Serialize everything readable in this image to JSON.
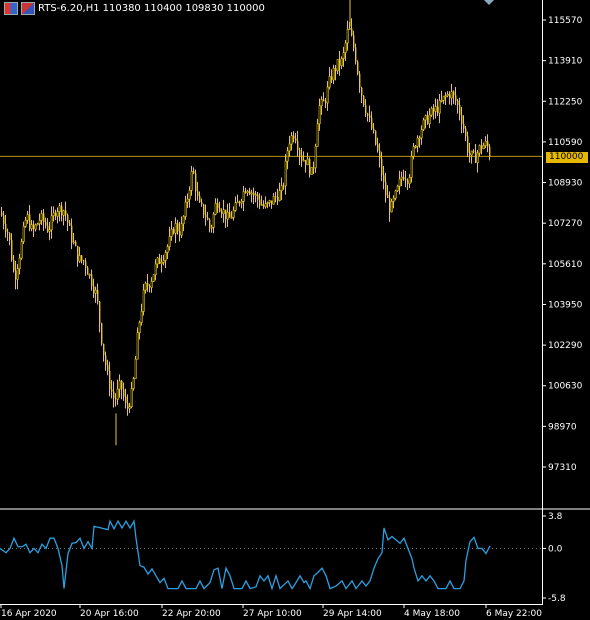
{
  "header": {
    "symbol": "RTS-6.20,H1",
    "ohlc": "110380 110400 109830 110000",
    "icons": [
      "chart-icon",
      "flag-icon"
    ]
  },
  "current_price_label": "110000",
  "colors": {
    "background": "#000000",
    "candle": "#e8c82e",
    "price_line": "#b8960f",
    "indicator": "#2a9fe0",
    "price_tag": "#e6b800"
  },
  "chart_data": [
    {
      "type": "candlestick",
      "ylim": [
        96000,
        117000
      ],
      "y_ticks": [
        "115570",
        "113910",
        "112250",
        "110590",
        "110000",
        "108930",
        "107270",
        "105610",
        "103950",
        "102290",
        "100630",
        "98970",
        "97310"
      ],
      "x_ticks": [
        "16 Apr 2020",
        "20 Apr 16:00",
        "22 Apr 20:00",
        "27 Apr 10:00",
        "29 Apr 14:00",
        "4 May 18:00",
        "6 May 22:00"
      ],
      "current_price": 110000,
      "path": [
        [
          0,
          107700
        ],
        [
          8,
          106800
        ],
        [
          14,
          105000
        ],
        [
          20,
          106200
        ],
        [
          26,
          107600
        ],
        [
          32,
          106900
        ],
        [
          40,
          107500
        ],
        [
          48,
          107000
        ],
        [
          56,
          107900
        ],
        [
          64,
          107800
        ],
        [
          70,
          106800
        ],
        [
          78,
          105800
        ],
        [
          84,
          105700
        ],
        [
          90,
          105000
        ],
        [
          96,
          104300
        ],
        [
          102,
          102200
        ],
        [
          108,
          100800
        ],
        [
          114,
          100000
        ],
        [
          120,
          100700
        ],
        [
          126,
          99600
        ],
        [
          132,
          100400
        ],
        [
          138,
          103000
        ],
        [
          144,
          104600
        ],
        [
          150,
          104900
        ],
        [
          156,
          105600
        ],
        [
          162,
          105900
        ],
        [
          168,
          106400
        ],
        [
          174,
          107200
        ],
        [
          180,
          106900
        ],
        [
          186,
          108100
        ],
        [
          192,
          109500
        ],
        [
          198,
          108000
        ],
        [
          204,
          107700
        ],
        [
          210,
          107000
        ],
        [
          216,
          108200
        ],
        [
          222,
          107800
        ],
        [
          228,
          107400
        ],
        [
          234,
          107800
        ],
        [
          240,
          108300
        ],
        [
          246,
          108800
        ],
        [
          252,
          108500
        ],
        [
          258,
          108200
        ],
        [
          264,
          107900
        ],
        [
          270,
          108100
        ],
        [
          276,
          108400
        ],
        [
          282,
          108600
        ],
        [
          288,
          110600
        ],
        [
          294,
          111000
        ],
        [
          300,
          110000
        ],
        [
          306,
          109800
        ],
        [
          312,
          109200
        ],
        [
          318,
          112000
        ],
        [
          324,
          112200
        ],
        [
          330,
          113200
        ],
        [
          336,
          113700
        ],
        [
          342,
          113900
        ],
        [
          348,
          115300
        ],
        [
          354,
          114300
        ],
        [
          360,
          112700
        ],
        [
          366,
          111800
        ],
        [
          372,
          111000
        ],
        [
          378,
          110000
        ],
        [
          384,
          108600
        ],
        [
          390,
          107800
        ],
        [
          396,
          108500
        ],
        [
          402,
          109300
        ],
        [
          408,
          109100
        ],
        [
          414,
          110500
        ],
        [
          420,
          111100
        ],
        [
          426,
          111500
        ],
        [
          432,
          111800
        ],
        [
          438,
          112000
        ],
        [
          444,
          112400
        ],
        [
          450,
          112600
        ],
        [
          456,
          112200
        ],
        [
          462,
          111400
        ],
        [
          468,
          110100
        ],
        [
          474,
          109900
        ],
        [
          480,
          110400
        ],
        [
          486,
          110500
        ],
        [
          490,
          110000
        ]
      ]
    },
    {
      "type": "line",
      "ylim": [
        -5.8,
        3.8
      ],
      "y_ticks": [
        "3.8",
        "0.0",
        "-5.8"
      ],
      "zero_line": 0.0,
      "values": [
        [
          0,
          0
        ],
        [
          6,
          -0.5
        ],
        [
          10,
          0
        ],
        [
          14,
          1.2
        ],
        [
          18,
          0.2
        ],
        [
          22,
          0.2
        ],
        [
          26,
          0.5
        ],
        [
          30,
          -0.5
        ],
        [
          34,
          0
        ],
        [
          38,
          -0.5
        ],
        [
          42,
          0.5
        ],
        [
          46,
          0
        ],
        [
          50,
          1.2
        ],
        [
          54,
          1.2
        ],
        [
          58,
          0
        ],
        [
          62,
          -2
        ],
        [
          64,
          -4.7
        ],
        [
          68,
          -0.6
        ],
        [
          72,
          0.6
        ],
        [
          76,
          0.7
        ],
        [
          80,
          1.2
        ],
        [
          84,
          0
        ],
        [
          88,
          0.8
        ],
        [
          92,
          0
        ],
        [
          94,
          2.6
        ],
        [
          108,
          2.2
        ],
        [
          110,
          3.2
        ],
        [
          114,
          2.3
        ],
        [
          118,
          3.2
        ],
        [
          122,
          2.4
        ],
        [
          126,
          3.2
        ],
        [
          130,
          2.4
        ],
        [
          134,
          3.2
        ],
        [
          136,
          1.2
        ],
        [
          140,
          -2
        ],
        [
          144,
          -2.2
        ],
        [
          148,
          -3
        ],
        [
          152,
          -2.4
        ],
        [
          156,
          -3.2
        ],
        [
          160,
          -4
        ],
        [
          164,
          -3.5
        ],
        [
          168,
          -4.7
        ],
        [
          178,
          -4.7
        ],
        [
          182,
          -3.8
        ],
        [
          186,
          -4.7
        ],
        [
          196,
          -4.7
        ],
        [
          200,
          -3.8
        ],
        [
          204,
          -4.7
        ],
        [
          210,
          -4
        ],
        [
          214,
          -2.5
        ],
        [
          218,
          -2.3
        ],
        [
          222,
          -4.7
        ],
        [
          226,
          -2.3
        ],
        [
          230,
          -3.2
        ],
        [
          234,
          -4.7
        ],
        [
          242,
          -4.7
        ],
        [
          246,
          -3.8
        ],
        [
          250,
          -4.7
        ],
        [
          256,
          -4.5
        ],
        [
          260,
          -3.2
        ],
        [
          264,
          -3.8
        ],
        [
          268,
          -3.2
        ],
        [
          272,
          -4.7
        ],
        [
          276,
          -3.2
        ],
        [
          280,
          -4.7
        ],
        [
          288,
          -3.8
        ],
        [
          292,
          -4.7
        ],
        [
          296,
          -4
        ],
        [
          300,
          -3.2
        ],
        [
          304,
          -4
        ],
        [
          306,
          -3.8
        ],
        [
          310,
          -4.7
        ],
        [
          314,
          -3.2
        ],
        [
          318,
          -2.8
        ],
        [
          322,
          -2.3
        ],
        [
          326,
          -3.2
        ],
        [
          330,
          -4.7
        ],
        [
          336,
          -4.4
        ],
        [
          342,
          -3.8
        ],
        [
          346,
          -4.7
        ],
        [
          352,
          -3.8
        ],
        [
          356,
          -4.7
        ],
        [
          362,
          -3.8
        ],
        [
          366,
          -4.4
        ],
        [
          370,
          -3.8
        ],
        [
          374,
          -2.3
        ],
        [
          378,
          -1.2
        ],
        [
          382,
          -0.5
        ],
        [
          384,
          2.4
        ],
        [
          388,
          1
        ],
        [
          392,
          1.4
        ],
        [
          396,
          1
        ],
        [
          400,
          0.6
        ],
        [
          404,
          1.2
        ],
        [
          408,
          0
        ],
        [
          412,
          -1.2
        ],
        [
          414,
          -2.3
        ],
        [
          418,
          -3.8
        ],
        [
          422,
          -3.2
        ],
        [
          426,
          -3.8
        ],
        [
          430,
          -3.2
        ],
        [
          434,
          -3.8
        ],
        [
          438,
          -4.7
        ],
        [
          446,
          -4.7
        ],
        [
          450,
          -3.8
        ],
        [
          454,
          -4.7
        ],
        [
          460,
          -4.7
        ],
        [
          464,
          -3.8
        ],
        [
          466,
          -1.4
        ],
        [
          470,
          0.8
        ],
        [
          474,
          1.3
        ],
        [
          478,
          0
        ],
        [
          482,
          0
        ],
        [
          486,
          -0.6
        ],
        [
          490,
          0.3
        ]
      ]
    }
  ]
}
